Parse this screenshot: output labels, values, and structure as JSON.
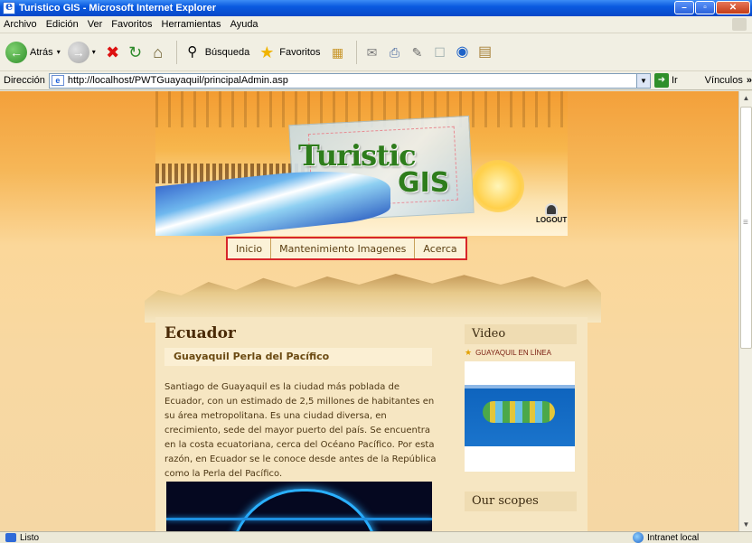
{
  "window": {
    "title": "Turistico GIS - Microsoft Internet Explorer"
  },
  "menubar": {
    "items": [
      "Archivo",
      "Edición",
      "Ver",
      "Favoritos",
      "Herramientas",
      "Ayuda"
    ]
  },
  "toolbar": {
    "back_label": "Atrás",
    "search_label": "Búsqueda",
    "favorites_label": "Favoritos"
  },
  "addressbar": {
    "label": "Dirección",
    "url": "http://localhost/PWTGuayaquil/principalAdmin.asp",
    "go_label": "Ir",
    "links_label": "Vínculos"
  },
  "banner": {
    "logo_part1": "Turistic",
    "logo_part2": "GIS",
    "logout_label": "LOGOUT"
  },
  "nav": {
    "items": [
      "Inicio",
      "Mantenimiento Imagenes",
      "Acerca"
    ]
  },
  "main": {
    "heading": "Ecuador",
    "subheading": "Guayaquil Perla del Pacífico",
    "body": "Santiago de Guayaquil es la ciudad más poblada de Ecuador, con un estimado de 2,5 millones de habitantes en su área metropolitana. Es una ciudad diversa, en crecimiento, sede del mayor puerto del país. Se encuentra en la costa ecuatoriana, cerca del Océano Pacífico. Por esta razón, en Ecuador se le conoce desde antes de la República como la Perla del Pacífico."
  },
  "sidebar": {
    "video_title": "Video",
    "video_link": "GUAYAQUIL EN LÍNEA",
    "scopes_title": "Our scopes"
  },
  "statusbar": {
    "status": "Listo",
    "zone": "Intranet local"
  }
}
